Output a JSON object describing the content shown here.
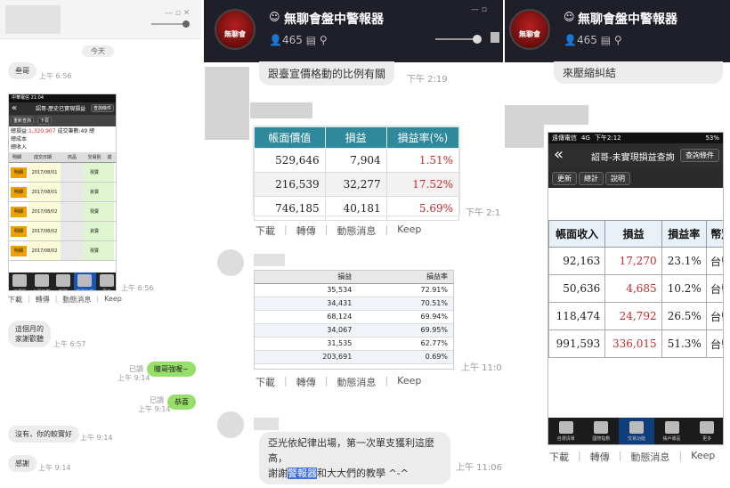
{
  "left_chat": {
    "date_divider": "今天",
    "msg1": {
      "text": "叁哥",
      "time": "上午 6:56"
    },
    "phone": {
      "status_carrier": "中華電信",
      "status_time": "21:04",
      "nav_title": "詔哥-歷史已實現損益",
      "nav_right_btn": "查詢條件",
      "btn_refresh": "重新查詢",
      "btn_next": "下頁",
      "summary_pnl_label": "總損益:",
      "summary_pnl_value": "1,320,907",
      "summary_count_label": "成交筆數:49",
      "summary_extra": "總",
      "summary_cost": "總成本",
      "summary_income": "總收入",
      "col_detail": "明細",
      "col_date": "成交日期",
      "col_product": "商品",
      "col_type": "交易別",
      "col_extra": "成",
      "rows": [
        {
          "detail": "明細",
          "date": "2017/08/01",
          "type": "現賣"
        },
        {
          "detail": "明細",
          "date": "2017/08/01",
          "type": "資賣"
        },
        {
          "detail": "明細",
          "date": "2017/08/02",
          "type": "現賣"
        },
        {
          "detail": "明細",
          "date": "2017/08/02",
          "type": "資賣"
        },
        {
          "detail": "明細",
          "date": "2017/08/02",
          "type": "現賣"
        }
      ],
      "tabs": [
        "自選股",
        "台股指數",
        "新聞",
        "交易功能",
        "更多"
      ]
    },
    "msg_phone_time": "上午 6:56",
    "actions": [
      "下載",
      "轉傳",
      "動態消息",
      "Keep"
    ],
    "msg2": {
      "text": "這個月的\n家謝歡聽",
      "time": "上午 6:57"
    },
    "msg3": {
      "text": "瞳哥強喔~",
      "read": "已讀",
      "time": "上午 9:14"
    },
    "msg4": {
      "text": "恭喜",
      "read": "已讀",
      "time": "上午 9:14"
    },
    "msg5": {
      "text": "沒有，你的較實好",
      "time": "上午 9:14"
    },
    "msg6": {
      "text": "感謝",
      "time": "上午 9:14"
    }
  },
  "mid_chat": {
    "header_title": "無聊會盤中警報器",
    "header_count": "465",
    "logo_text": "無聊會",
    "logo_sub": "BoringChat",
    "bubble_top": {
      "text": "跟臺宣價格動的比例有關",
      "time": "下午 2:19"
    },
    "table1": {
      "headers": [
        "帳面價值",
        "損益",
        "損益率(%)"
      ],
      "rows": [
        [
          "529,646",
          "7,904",
          "1.51%"
        ],
        [
          "216,539",
          "32,277",
          "17.52%"
        ],
        [
          "746,185",
          "40,181",
          "5.69%"
        ]
      ],
      "time": "下午 2:1"
    },
    "actions": [
      "下載",
      "轉傳",
      "動態消息",
      "Keep"
    ],
    "table2": {
      "headers": [
        "損益",
        "損益率"
      ],
      "rows": [
        [
          "35,534",
          "72.91%"
        ],
        [
          "34,431",
          "70.51%"
        ],
        [
          "68,124",
          "69.94%"
        ],
        [
          "34,067",
          "69.95%"
        ],
        [
          "31,535",
          "62.77%"
        ],
        [
          "203,691",
          "0.69%"
        ]
      ],
      "time": "上午 11:0"
    },
    "actions2": [
      "下載",
      "轉傳",
      "動態消息",
      "Keep"
    ],
    "bubble_bottom": {
      "line1": "亞光依紀律出場，第一次單支獲利這麼高，",
      "line2_pre": "謝謝",
      "line2_highlight": "警報器",
      "line2_post": "和大大們的教學 ^-^",
      "time": "上午 11:06"
    }
  },
  "right_chat": {
    "header_title": "無聊會盤中警報器",
    "header_count": "465",
    "logo_text": "無聊會",
    "bubble_top": "來壓縮糾結",
    "phone": {
      "status_carrier": "遠傳電信",
      "status_net": "4G",
      "status_time": "下午2:12",
      "status_batt": "53%",
      "nav_title": "詔哥-未實現損益查詢",
      "nav_right_btn": "查詢條件",
      "btn_refresh": "更新",
      "btn_total": "總計",
      "btn_help": "說明",
      "headers": [
        "帳面收入",
        "損益",
        "損益率",
        "幣別"
      ],
      "rows": [
        [
          "92,163",
          "17,270",
          "23.1%",
          "台幣"
        ],
        [
          "50,636",
          "4,685",
          "10.2%",
          "台幣"
        ],
        [
          "118,474",
          "24,792",
          "26.5%",
          "台幣"
        ],
        [
          "991,593",
          "336,015",
          "51.3%",
          "台幣"
        ]
      ],
      "tabs": [
        "自選清單",
        "國際指數",
        "交易功能",
        "帳戶專區",
        "更多"
      ]
    },
    "actions": [
      "下載",
      "轉傳",
      "動態消息",
      "Keep"
    ]
  },
  "colors": {
    "header_bg": "#1f1f2a",
    "table_header": "#2e8a9b",
    "red": "#c42b2b",
    "green_bubble": "#96e06a"
  }
}
